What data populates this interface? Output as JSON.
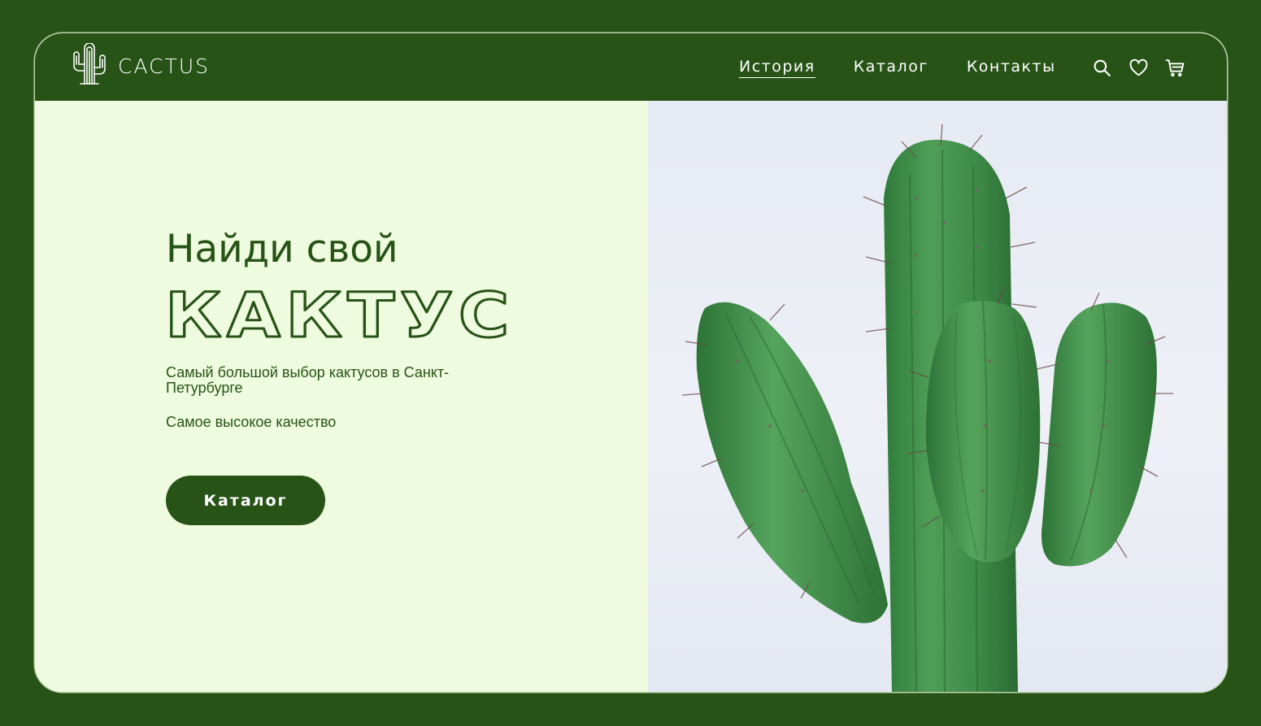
{
  "brand": {
    "name": "CACTUS",
    "icon": "cactus-logo-icon"
  },
  "nav": {
    "items": [
      {
        "label": "История",
        "active": true
      },
      {
        "label": "Каталог",
        "active": false
      },
      {
        "label": "Контакты",
        "active": false
      }
    ]
  },
  "header_icons": [
    "search-icon",
    "heart-icon",
    "cart-icon"
  ],
  "hero": {
    "headline": "Найди свой",
    "big_word": "КАКТУС",
    "subtitle": "Самый большой выбор кактусов в Санкт-Петурбурге",
    "tagline": "Самое высокое качество",
    "cta_label": "Каталог",
    "image": "cactus-photo"
  },
  "colors": {
    "primary": "#275317",
    "background": "#eefbde",
    "accent_text": "#ffffff",
    "photo_bg": "#e9ecf4"
  }
}
